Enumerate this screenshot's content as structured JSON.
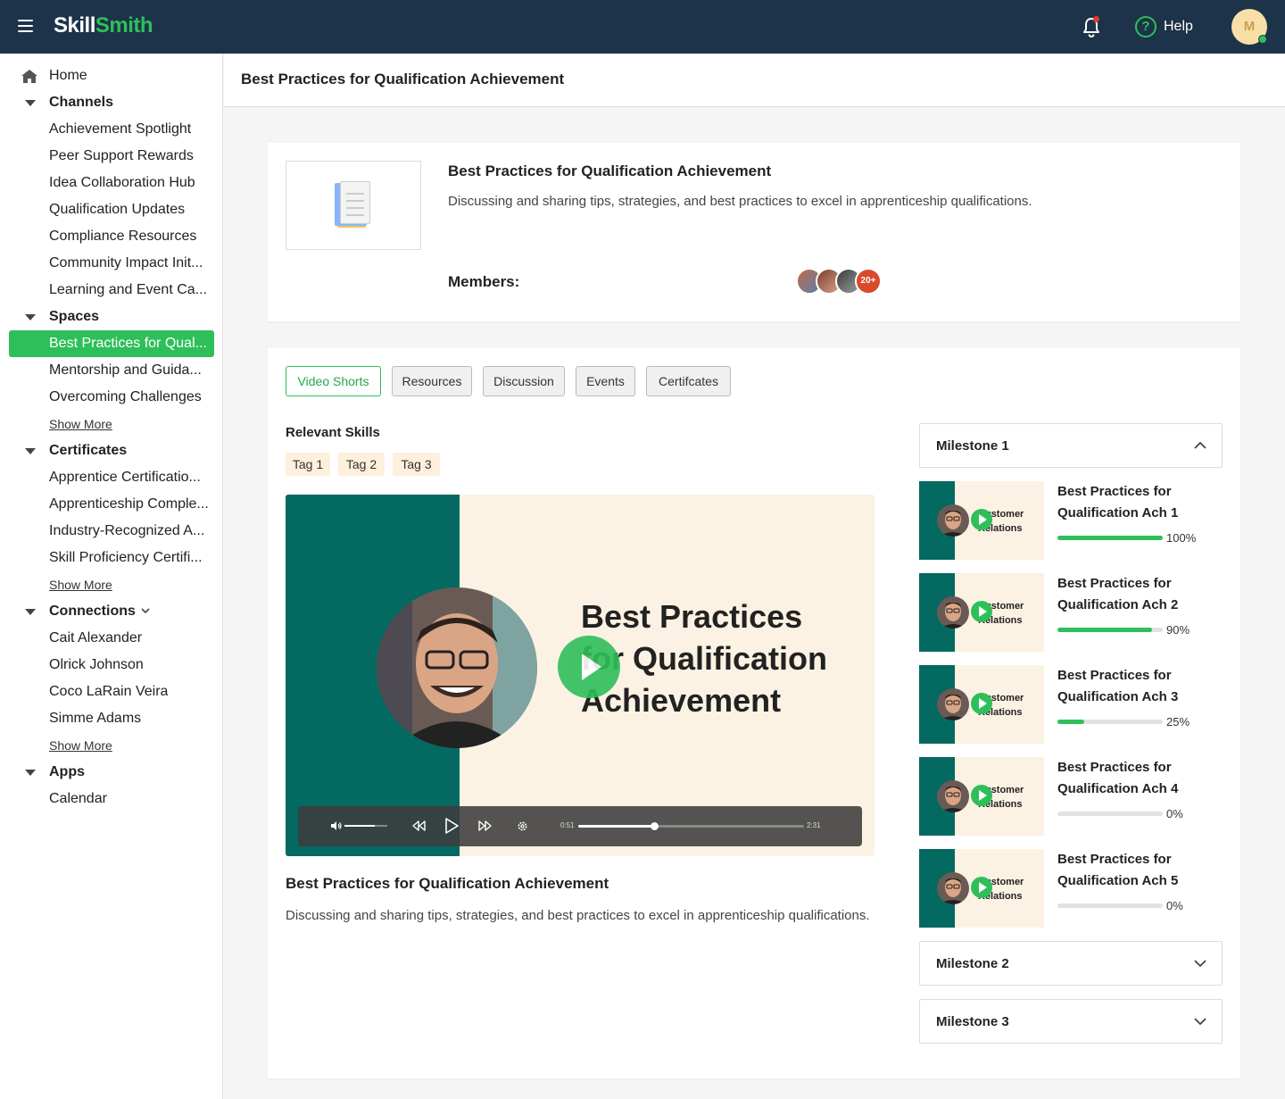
{
  "header": {
    "logo_part1": "Skill",
    "logo_part2": "Smith",
    "help_label": "Help",
    "avatar_initial": "M"
  },
  "sidebar": {
    "home": "Home",
    "channels": {
      "label": "Channels",
      "items": [
        "Achievement Spotlight",
        "Peer Support Rewards",
        "Idea Collaboration Hub",
        "Qualification Updates",
        "Compliance Resources",
        "Community Impact Init...",
        "Learning and Event Ca..."
      ]
    },
    "spaces": {
      "label": "Spaces",
      "items": [
        "Best Practices for Qual...",
        "Mentorship and Guida...",
        "Overcoming Challenges"
      ],
      "show_more": "Show More"
    },
    "certificates": {
      "label": "Certificates",
      "items": [
        "Apprentice Certificatio...",
        "Apprenticeship Comple...",
        "Industry-Recognized A...",
        "Skill Proficiency Certifi..."
      ],
      "show_more": "Show More"
    },
    "connections": {
      "label": "Connections",
      "items": [
        "Cait Alexander",
        "Olrick Johnson",
        "Coco LaRain Veira",
        "Simme Adams"
      ],
      "show_more": "Show More"
    },
    "apps": {
      "label": "Apps",
      "items": [
        "Calendar"
      ]
    }
  },
  "page": {
    "title": "Best Practices for Qualification Achievement"
  },
  "space_card": {
    "title": "Best Practices for Qualification Achievement",
    "description": "Discussing and sharing tips, strategies, and best practices to excel in apprenticeship qualifications.",
    "members_label": "Members:",
    "members_more": "20+"
  },
  "tabs": [
    "Video Shorts",
    "Resources",
    "Discussion",
    "Events",
    "Certifcates"
  ],
  "skills": {
    "label": "Relevant Skills",
    "tags": [
      "Tag 1",
      "Tag 2",
      "Tag 3"
    ]
  },
  "video": {
    "overlay_line1": "Best Practices",
    "overlay_line2": "for Qualification",
    "overlay_line3": "Achievement",
    "current_time": "0:51",
    "duration": "2:31",
    "progress_fraction": 0.337,
    "volume_fraction": 0.7,
    "title": "Best Practices for Qualification Achievement",
    "description": "Discussing and sharing tips, strategies, and best practices to excel in apprenticeship qualifications."
  },
  "milestones": [
    {
      "label": "Milestone 1",
      "expanded": true
    },
    {
      "label": "Milestone 2",
      "expanded": false
    },
    {
      "label": "Milestone 3",
      "expanded": false
    }
  ],
  "lessons": [
    {
      "title": "Best Practices for Qualification Ach 1",
      "progress": 100,
      "progress_label": "100%",
      "thumb_line1": "Customer",
      "thumb_line2": "Relations"
    },
    {
      "title": "Best Practices for Qualification Ach 2",
      "progress": 90,
      "progress_label": "90%",
      "thumb_line1": "Customer",
      "thumb_line2": "Relations"
    },
    {
      "title": "Best Practices for Qualification Ach 3",
      "progress": 25,
      "progress_label": "25%",
      "thumb_line1": "Customer",
      "thumb_line2": "Relations"
    },
    {
      "title": "Best Practices for Qualification Ach 4",
      "progress": 0,
      "progress_label": "0%",
      "thumb_line1": "Customer",
      "thumb_line2": "Relations"
    },
    {
      "title": "Best Practices for Qualification Ach 5",
      "progress": 0,
      "progress_label": "0%",
      "thumb_line1": "Customer",
      "thumb_line2": "Relations"
    }
  ],
  "colors": {
    "brand_green": "#2fbf5a",
    "header_navy": "#1d3349",
    "video_teal": "#046960",
    "video_cream": "#fbf2e3",
    "tag_bg": "#fdf0dc",
    "notification_red": "#e53935"
  }
}
